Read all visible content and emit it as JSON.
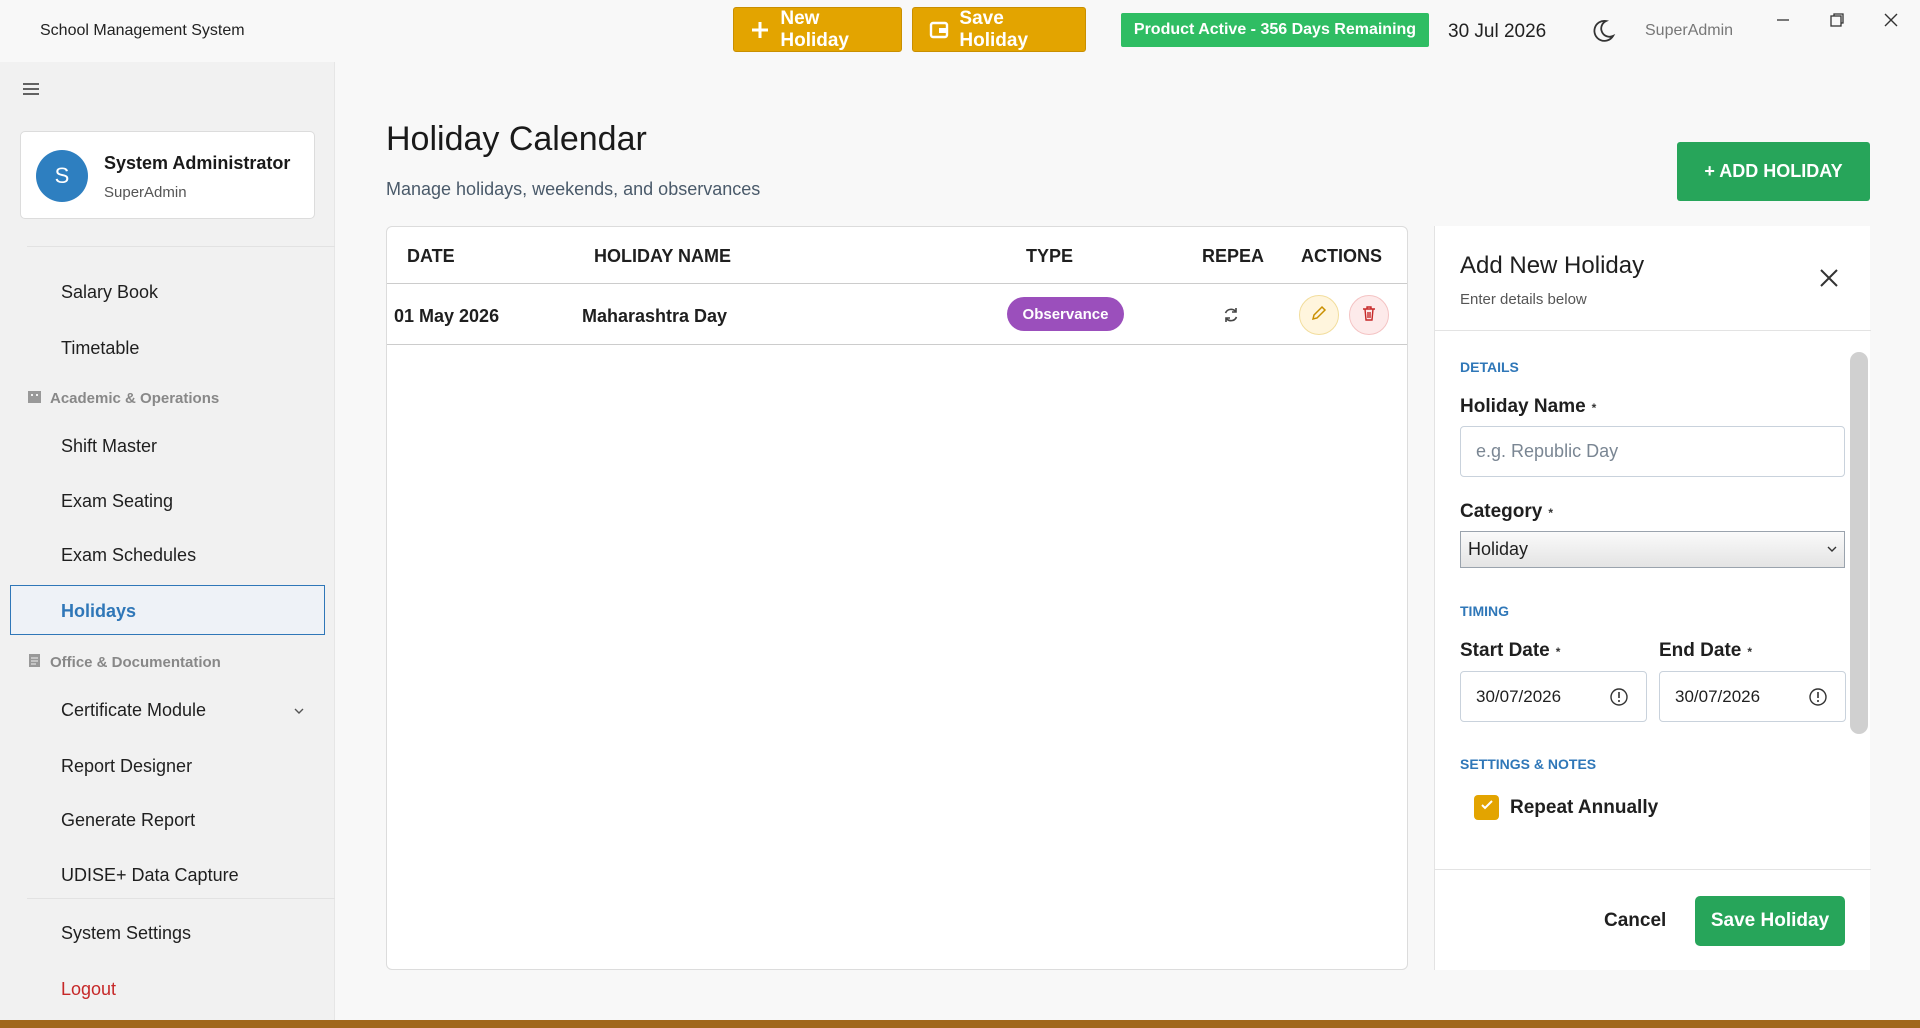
{
  "app": {
    "title": "School Management System",
    "date": "30 Jul 2026",
    "user": "SuperAdmin",
    "product_status": "Product Active - 356 Days Remaining"
  },
  "toolbar": {
    "new_holiday": "New Holiday",
    "save_holiday": "Save Holiday"
  },
  "profile": {
    "initial": "S",
    "name": "System Administrator",
    "role": "SuperAdmin"
  },
  "sidebar": {
    "items": {
      "salary_book": "Salary Book",
      "timetable": "Timetable",
      "shift_master": "Shift Master",
      "exam_seating": "Exam Seating",
      "exam_schedules": "Exam Schedules",
      "holidays": "Holidays",
      "certificate_module": "Certificate Module",
      "report_designer": "Report Designer",
      "generate_report": "Generate Report",
      "udise": "UDISE+ Data Capture",
      "system_settings": "System Settings",
      "logout": "Logout"
    },
    "sections": {
      "academic": "Academic & Operations",
      "office": "Office & Documentation"
    }
  },
  "page": {
    "title": "Holiday Calendar",
    "subtitle": "Manage holidays, weekends, and observances",
    "add_button": "+ ADD HOLIDAY"
  },
  "table": {
    "headers": {
      "date": "DATE",
      "name": "HOLIDAY NAME",
      "type": "TYPE",
      "repeat": "REPEA",
      "actions": "ACTIONS"
    },
    "rows": [
      {
        "date": "01 May 2026",
        "name": "Maharashtra Day",
        "type": "Observance"
      }
    ]
  },
  "form": {
    "title": "Add New Holiday",
    "subtitle": "Enter details below",
    "sections": {
      "details": "DETAILS",
      "timing": "TIMING",
      "settings": "SETTINGS & NOTES"
    },
    "labels": {
      "name": "Holiday Name",
      "category": "Category",
      "start": "Start Date",
      "end": "End Date",
      "required": "*"
    },
    "name_placeholder": "e.g. Republic Day",
    "category_value": "Holiday",
    "start_date": "30/07/2026",
    "end_date": "30/07/2026",
    "repeat_label": "Repeat Annually",
    "repeat_checked": true,
    "cancel": "Cancel",
    "save": "Save Holiday"
  },
  "colors": {
    "accent": "#e3a400",
    "primary": "#27a55a",
    "link": "#2f77b8",
    "danger": "#c62828",
    "observance": "#9b4fbc"
  }
}
